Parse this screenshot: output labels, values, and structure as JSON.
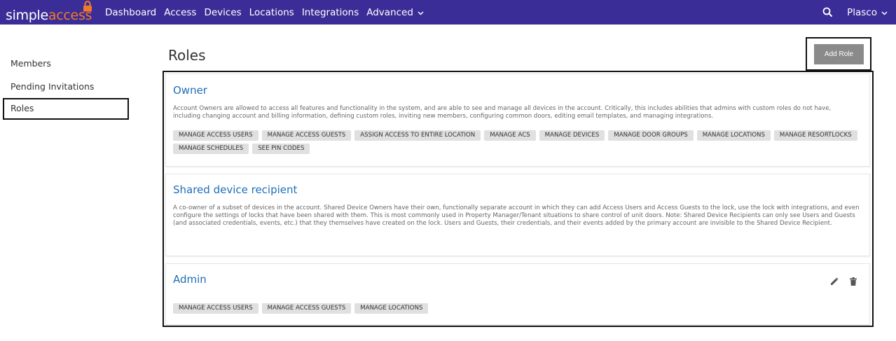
{
  "nav": {
    "logo_simple": "simple",
    "logo_access": "access",
    "links": [
      "Dashboard",
      "Access",
      "Devices",
      "Locations",
      "Integrations"
    ],
    "advanced": "Advanced",
    "account": "Plasco",
    "search_icon": "search-icon",
    "brand_color": "#3b2d97",
    "logo_accent": "#f07a2a"
  },
  "sidebar": {
    "items": [
      {
        "label": "Members"
      },
      {
        "label": "Pending Invitations"
      },
      {
        "label": "Roles"
      }
    ]
  },
  "page": {
    "title": "Roles",
    "add_role_label": "Add Role"
  },
  "roles": [
    {
      "title": "Owner",
      "description": "Account Owners are allowed to access all features and functionality in the system, and are able to see and manage all devices in the account. Critically, this includes abilities that admins with custom roles do not have, including changing account and billing information, defining custom roles, inviting new members, configuring common doors, editing email templates, and managing integrations.",
      "tags": [
        "MANAGE ACCESS USERS",
        "MANAGE ACCESS GUESTS",
        "ASSIGN ACCESS TO ENTIRE LOCATION",
        "MANAGE ACS",
        "MANAGE DEVICES",
        "MANAGE DOOR GROUPS",
        "MANAGE LOCATIONS",
        "MANAGE RESORTLOCKS",
        "MANAGE SCHEDULES",
        "SEE PIN CODES"
      ]
    },
    {
      "title": "Shared device recipient",
      "description": "A co-owner of a subset of devices in the account. Shared Device Owners have their own, functionally separate account in which they can add Access Users and Access Guests to the lock, use the lock with integrations, and even configure the settings of locks that have been shared with them. This is most commonly used in Property Manager/Tenant situations to share control of unit doors. Note: Shared Device Recipients can only see Users and Guests (and associated credentials, events, etc.) that they themselves have created on the lock. Users and Guests, their credentials, and their events added by the primary account are invisible to the Shared Device Recipient.",
      "tags": []
    },
    {
      "title": "Admin",
      "description": "",
      "tags": [
        "MANAGE ACCESS USERS",
        "MANAGE ACCESS GUESTS",
        "MANAGE LOCATIONS"
      ],
      "edit_icon": "pencil-icon",
      "delete_icon": "trash-icon"
    }
  ]
}
